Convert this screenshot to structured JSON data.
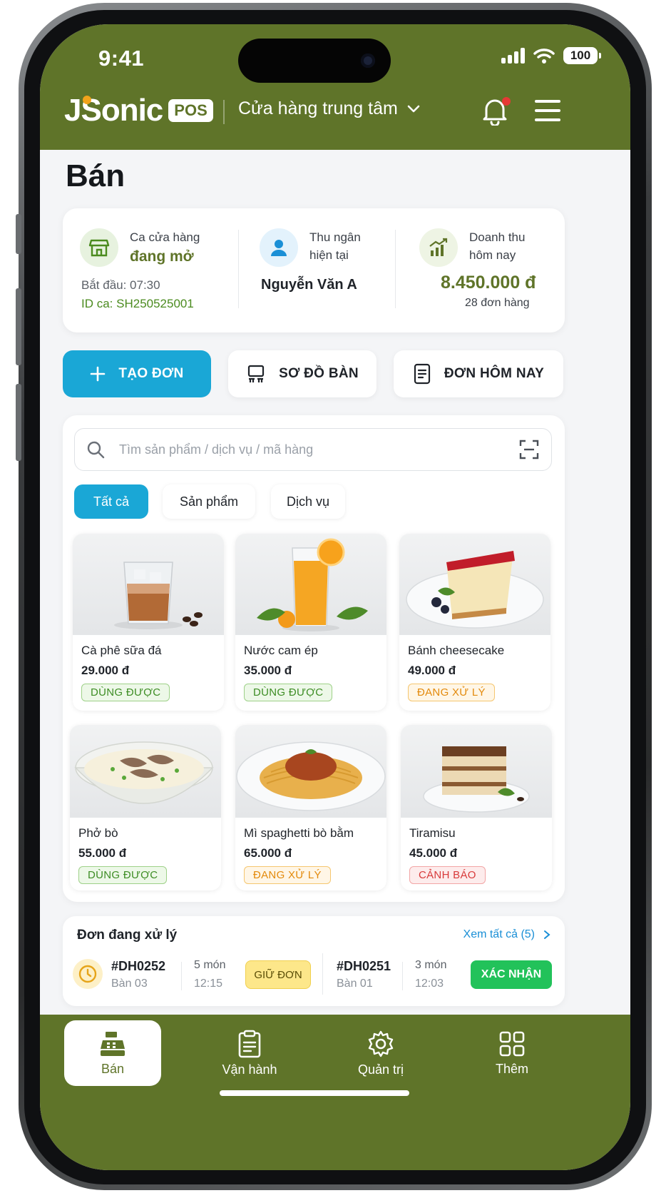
{
  "status_bar": {
    "time": "9:41",
    "battery": "100"
  },
  "header": {
    "logo_text": "JSonic",
    "logo_badge": "POS",
    "store": "Cửa hàng trung tâm"
  },
  "page_title": "Bán",
  "shift": {
    "label": "Ca cửa hàng",
    "status": "đang mở",
    "start": "Bắt đầu: 07:30",
    "shift_id": "ID ca: SH250525001"
  },
  "cashier": {
    "label_line1": "Thu ngân",
    "label_line2": "hiện tại",
    "name": "Nguyễn Văn A"
  },
  "revenue": {
    "label_line1": "Doanh thu",
    "label_line2": "hôm nay",
    "amount": "8.450.000 đ",
    "orders": "28 đơn hàng"
  },
  "actions": {
    "create_order": "TẠO ĐƠN",
    "table_map": "SƠ ĐỒ BÀN",
    "today_orders": "ĐƠN HÔM NAY"
  },
  "search": {
    "placeholder": "Tìm sản phẩm / dịch vụ / mã hàng"
  },
  "filters": [
    "Tất cả",
    "Sản phẩm",
    "Dịch vụ"
  ],
  "products": [
    {
      "name": "Cà phê sữa đá",
      "price": "29.000 đ",
      "status": "DÙNG ĐƯỢC"
    },
    {
      "name": "Nước cam ép",
      "price": "35.000 đ",
      "status": "DÙNG ĐƯỢC"
    },
    {
      "name": "Bánh cheesecake",
      "price": "49.000 đ",
      "status": "ĐANG XỬ LÝ"
    },
    {
      "name": "Phở bò",
      "price": "55.000 đ",
      "status": "DÙNG ĐƯỢC"
    },
    {
      "name": "Mì spaghetti bò bằm",
      "price": "65.000 đ",
      "status": "ĐANG XỬ LÝ"
    },
    {
      "name": "Tiramisu",
      "price": "45.000 đ",
      "status": "CẢNH BÁO"
    }
  ],
  "pending": {
    "title": "Đơn đang xử lý",
    "view_all": "Xem tất cả (5)",
    "orders": [
      {
        "id": "#DH0252",
        "table": "Bàn 03",
        "items": "5 món",
        "time": "12:15",
        "action": "GIỮ ĐƠN"
      },
      {
        "id": "#DH0251",
        "table": "Bàn 01",
        "items": "3 món",
        "time": "12:03",
        "action": "XÁC NHẬN"
      }
    ]
  },
  "nav": [
    "Bán",
    "Vận hành",
    "Quản trị",
    "Thêm"
  ],
  "colors": {
    "brand_olive": "#5f7429",
    "accent_blue": "#1aa7d6",
    "status_green": "#3d8d24",
    "status_orange": "#e38a0c",
    "status_red": "#d83a3a",
    "confirm_green": "#22c25a"
  }
}
